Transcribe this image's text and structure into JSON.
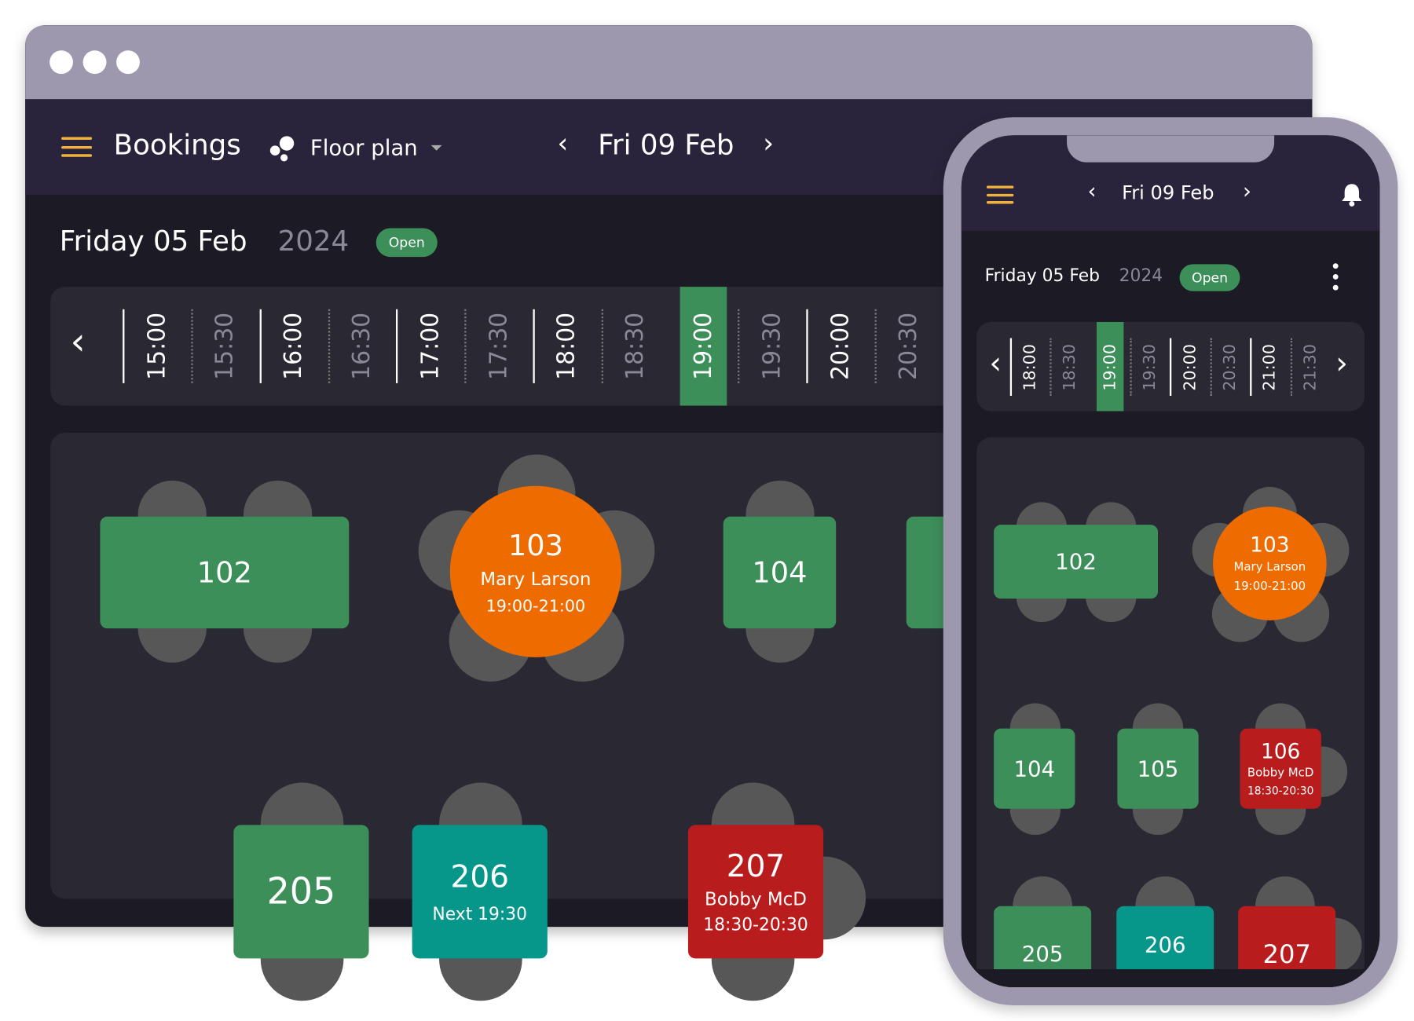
{
  "desktop": {
    "header": {
      "title": "Bookings",
      "view_label": "Floor plan",
      "date": "Fri 09 Feb"
    },
    "day": {
      "title": "Friday 05 Feb",
      "year": "2024",
      "status": "Open"
    },
    "timeline": {
      "slots": [
        "15:00",
        "15:30",
        "16:00",
        "16:30",
        "17:00",
        "17:30",
        "18:00",
        "18:30",
        "19:00",
        "19:30",
        "20:00",
        "20:30"
      ],
      "selected": "19:00"
    },
    "tables": [
      {
        "number": "102",
        "status": "free"
      },
      {
        "number": "103",
        "name": "Mary Larson",
        "time": "19:00-21:00",
        "status": "seated"
      },
      {
        "number": "104",
        "status": "free"
      },
      {
        "number": "205",
        "status": "free"
      },
      {
        "number": "206",
        "note": "Next 19:30",
        "status": "upcoming"
      },
      {
        "number": "207",
        "name": "Bobby McD",
        "time": "18:30-20:30",
        "status": "occupied"
      }
    ]
  },
  "mobile": {
    "header": {
      "date": "Fri 09 Feb"
    },
    "day": {
      "title": "Friday 05 Feb",
      "year": "2024",
      "status": "Open"
    },
    "timeline": {
      "slots": [
        "18:00",
        "18:30",
        "19:00",
        "19:30",
        "20:00",
        "20:30",
        "21:00",
        "21:30"
      ],
      "selected": "19:00"
    },
    "tables": [
      {
        "number": "102"
      },
      {
        "number": "103",
        "name": "Mary Larson",
        "time": "19:00-21:00"
      },
      {
        "number": "104"
      },
      {
        "number": "105"
      },
      {
        "number": "106",
        "name": "Bobby McD",
        "time": "18:30-20:30"
      },
      {
        "number": "205"
      },
      {
        "number": "206"
      },
      {
        "number": "207"
      }
    ]
  },
  "colors": {
    "free": "#3d8f5a",
    "seated": "#ee6b00",
    "upcoming": "#07968a",
    "occupied": "#b91c1c",
    "accent": "#f0b23f",
    "selected_slot": "#3d8f5a"
  }
}
